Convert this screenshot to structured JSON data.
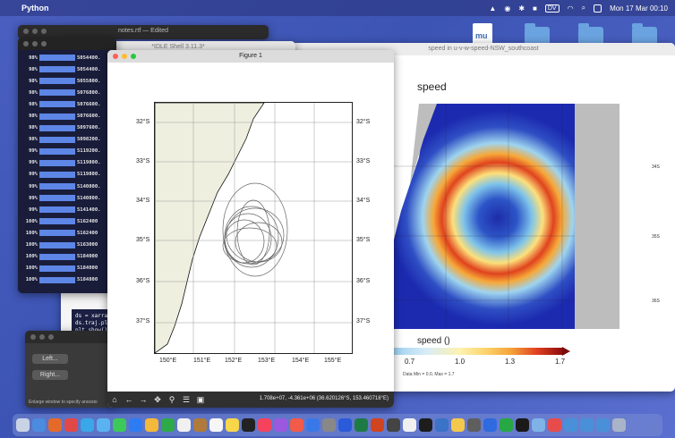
{
  "menubar": {
    "app_name": "Python",
    "clock": "Mon 17 Mar  00:10",
    "dv": "DV"
  },
  "desktop": {
    "file_icon_text": "mu"
  },
  "terminal": {
    "rows": [
      {
        "pct": "98%",
        "val": "5054400."
      },
      {
        "pct": "98%",
        "val": "5054400."
      },
      {
        "pct": "98%",
        "val": "5055800."
      },
      {
        "pct": "98%",
        "val": "5076800."
      },
      {
        "pct": "98%",
        "val": "5076600."
      },
      {
        "pct": "98%",
        "val": "5076600."
      },
      {
        "pct": "98%",
        "val": "5097600."
      },
      {
        "pct": "98%",
        "val": "5098200."
      },
      {
        "pct": "99%",
        "val": "5119200."
      },
      {
        "pct": "99%",
        "val": "5119800."
      },
      {
        "pct": "99%",
        "val": "5119800."
      },
      {
        "pct": "99%",
        "val": "5140800."
      },
      {
        "pct": "99%",
        "val": "5140800."
      },
      {
        "pct": "99%",
        "val": "5141400."
      },
      {
        "pct": "100%",
        "val": "5162400"
      },
      {
        "pct": "100%",
        "val": "5162400"
      },
      {
        "pct": "100%",
        "val": "5163000"
      },
      {
        "pct": "100%",
        "val": "5184000"
      },
      {
        "pct": "100%",
        "val": "5184000"
      },
      {
        "pct": "100%",
        "val": "5184800"
      }
    ]
  },
  "notes_window": {
    "title": "notes.rtf — Edited"
  },
  "shell": {
    "title": "*IDLE Shell 3.11.3*",
    "code": [
      "ds = xarray",
      "ds.traj.plo",
      "plt.show()"
    ]
  },
  "left_panel": {
    "left_btn": "Left...",
    "right_btn": "Right...",
    "note": "Enlarge window to specify ancesto"
  },
  "speed_window": {
    "title": "speed in u-v-w-speed-NSW_southcoast",
    "plot_title": "speed",
    "right_ticks": [
      "34S",
      "35S",
      "36S"
    ],
    "colorbar_title": "speed ()",
    "colorbar_labels": [
      "0.7",
      "1.0",
      "1.3",
      "1.7"
    ],
    "minmax": "Data Min = 0.0, Max = 1.7"
  },
  "figure": {
    "title": "Figure 1",
    "lat_labels": [
      "32°S",
      "33°S",
      "34°S",
      "35°S",
      "36°S",
      "37°S"
    ],
    "lon_labels": [
      "150°E",
      "151°E",
      "152°E",
      "153°E",
      "154°E",
      "155°E"
    ],
    "coords": "1.708e+07, -4.361e+06 (36.620126°S, 153.460718°E)",
    "toolbar": [
      "home-icon",
      "back-icon",
      "forward-icon",
      "pan-icon",
      "zoom-icon",
      "configure-icon",
      "save-icon"
    ]
  }
}
